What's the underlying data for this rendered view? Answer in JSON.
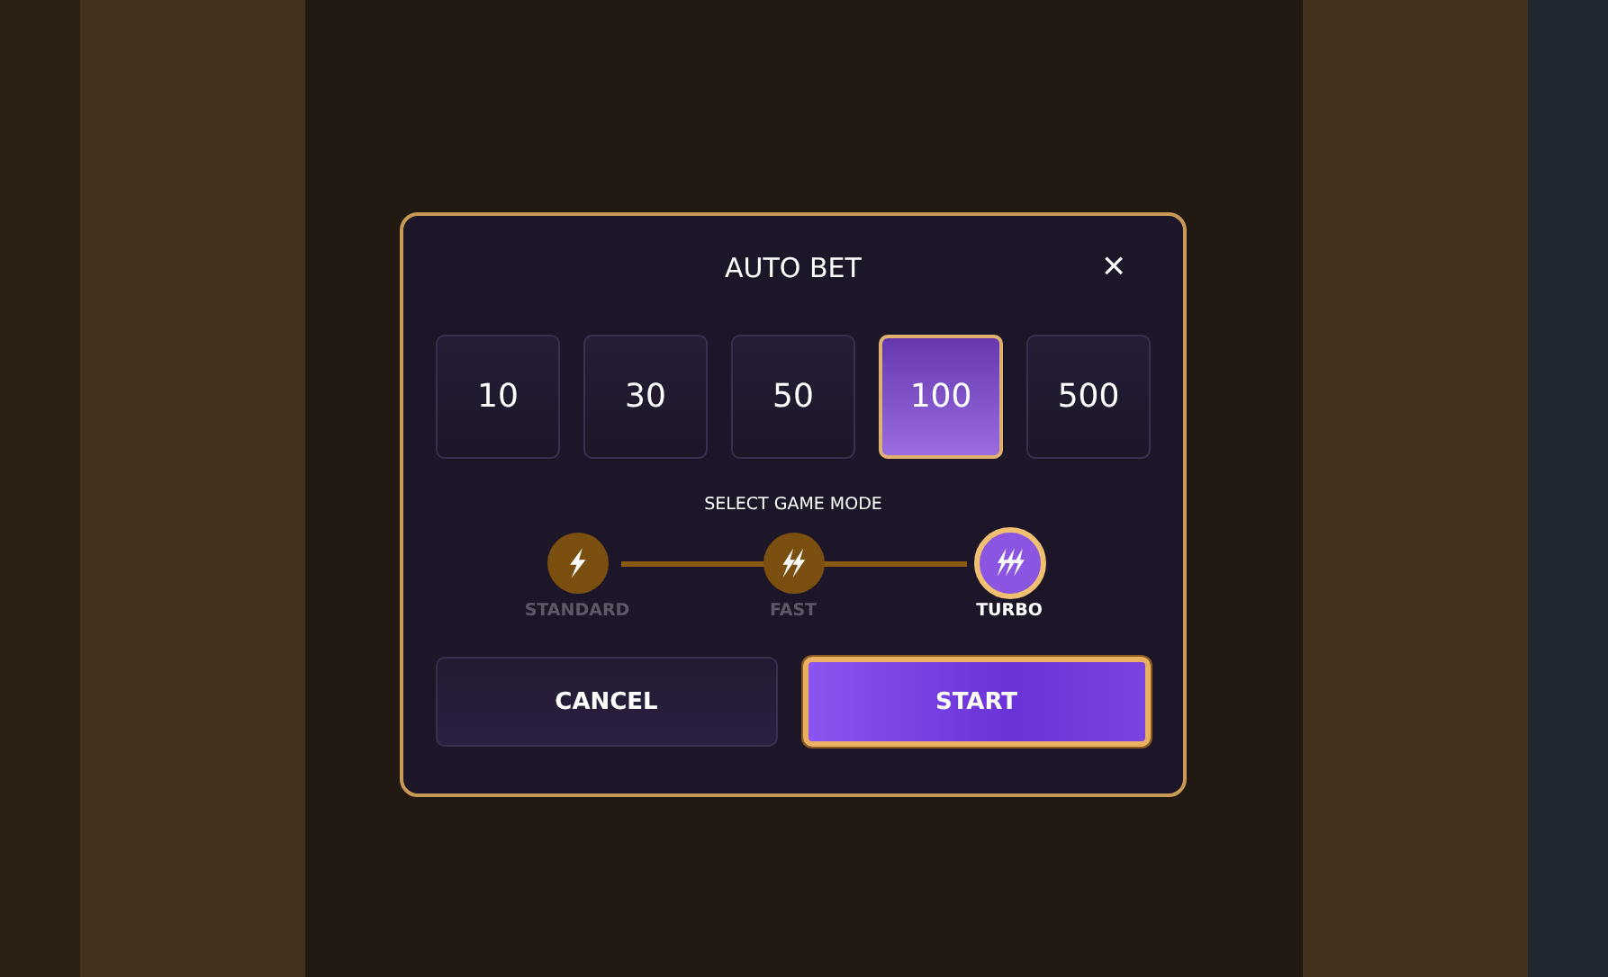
{
  "dialog": {
    "title": "AUTO BET",
    "close": "×",
    "bets": [
      {
        "label": "10",
        "selected": false
      },
      {
        "label": "30",
        "selected": false
      },
      {
        "label": "50",
        "selected": false
      },
      {
        "label": "100",
        "selected": true
      },
      {
        "label": "500",
        "selected": false
      }
    ],
    "mode_heading": "SELECT GAME MODE",
    "modes": [
      {
        "label": "STANDARD",
        "selected": false
      },
      {
        "label": "FAST",
        "selected": false
      },
      {
        "label": "TURBO",
        "selected": true
      }
    ],
    "buttons": [
      {
        "label": "CANCEL",
        "kind": "secondary"
      },
      {
        "label": "START",
        "kind": "primary"
      }
    ]
  }
}
